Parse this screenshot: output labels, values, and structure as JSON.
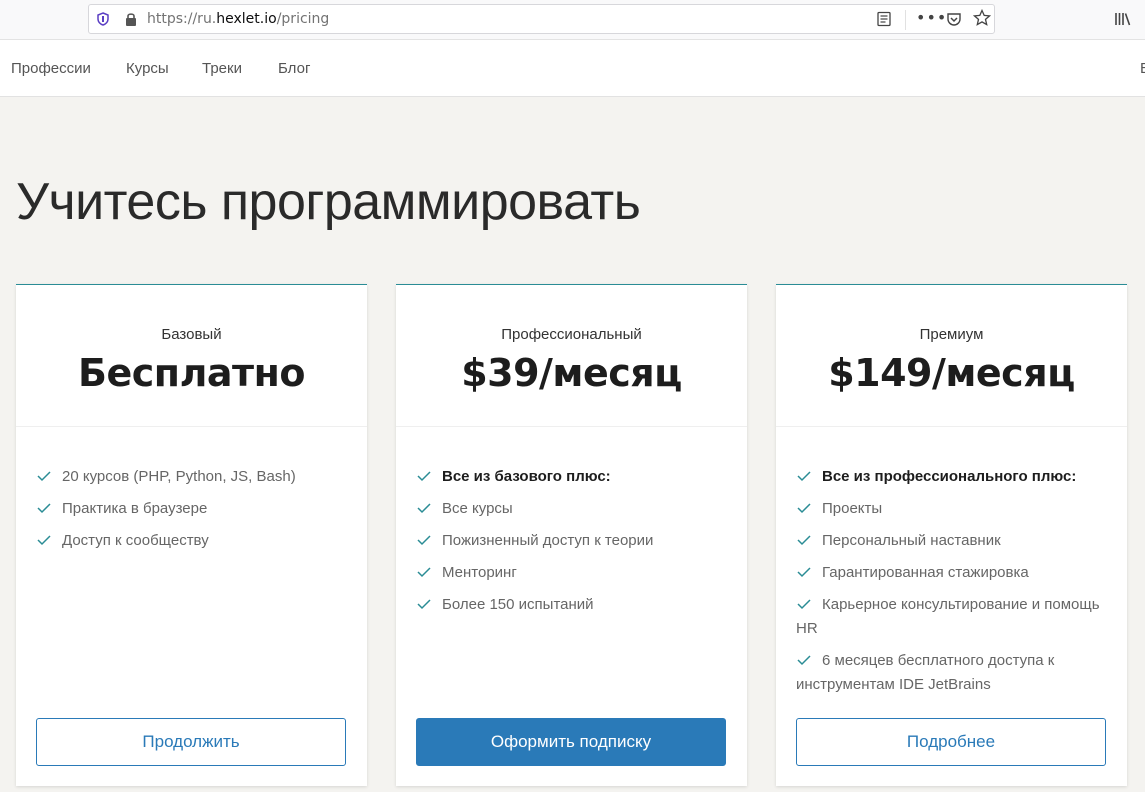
{
  "browser": {
    "url_scheme": "https://ru.",
    "url_host": "hexlet.io",
    "url_path": "/pricing",
    "menu_dots": "•••"
  },
  "nav": {
    "items": [
      {
        "label": "Профессии"
      },
      {
        "label": "Курсы"
      },
      {
        "label": "Треки"
      },
      {
        "label": "Блог"
      }
    ],
    "cut_item": "Е"
  },
  "heading": "Учитесь программировать",
  "accent_color": "#2a7ab8",
  "check_color": "#2a8c95",
  "plans": [
    {
      "tier": "Базовый",
      "price": "Бесплатно",
      "features": [
        {
          "text": "20 курсов (PHP, Python, JS, Bash)",
          "bold": false
        },
        {
          "text": "Практика в браузере",
          "bold": false
        },
        {
          "text": "Доступ к сообществу",
          "bold": false
        }
      ],
      "button": "Продолжить",
      "primary": false
    },
    {
      "tier": "Профессиональный",
      "price": "$39/месяц",
      "features": [
        {
          "text": "Все из базового плюс:",
          "bold": true
        },
        {
          "text": "Все курсы",
          "bold": false
        },
        {
          "text": "Пожизненный доступ к теории",
          "bold": false
        },
        {
          "text": "Менторинг",
          "bold": false
        },
        {
          "text": "Более 150 испытаний",
          "bold": false
        }
      ],
      "button": "Оформить подписку",
      "primary": true
    },
    {
      "tier": "Премиум",
      "price": "$149/месяц",
      "features": [
        {
          "text": "Все из профессионального плюс:",
          "bold": true
        },
        {
          "text": "Проекты",
          "bold": false
        },
        {
          "text": "Персональный наставник",
          "bold": false
        },
        {
          "text": "Гарантированная стажировка",
          "bold": false
        },
        {
          "text": "Карьерное консультирование и помощь HR",
          "bold": false
        },
        {
          "text": "6 месяцев бесплатного доступа к инструментам IDE JetBrains",
          "bold": false
        }
      ],
      "button": "Подробнее",
      "primary": false
    }
  ]
}
